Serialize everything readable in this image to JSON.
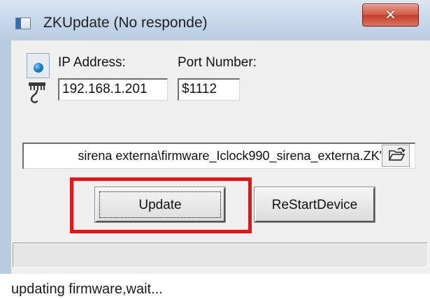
{
  "window": {
    "title": "ZKUpdate (No responde)",
    "close_glyph": "✕"
  },
  "connection": {
    "ip_label": "IP Address:",
    "ip_value": "192.168.1.201",
    "port_label": "Port Number:",
    "port_value": "$1112",
    "icons": [
      "globe-icon",
      "network-cable-icon"
    ]
  },
  "firmware": {
    "file_path": "sirena externa\\firmware_Iclock990_sirena_externa.ZK\"",
    "browse_icon": "folder-open-icon"
  },
  "buttons": {
    "update_label": "Update",
    "restart_label": "ReStartDevice"
  },
  "progress": {
    "fraction": 0
  },
  "status": {
    "message": "updating firmware,wait..."
  },
  "colors": {
    "highlight": "#ee1111",
    "title_bar": "#c7d9eb",
    "dialog_bg": "#f0f0f0",
    "close_button": "#c43f2a"
  }
}
